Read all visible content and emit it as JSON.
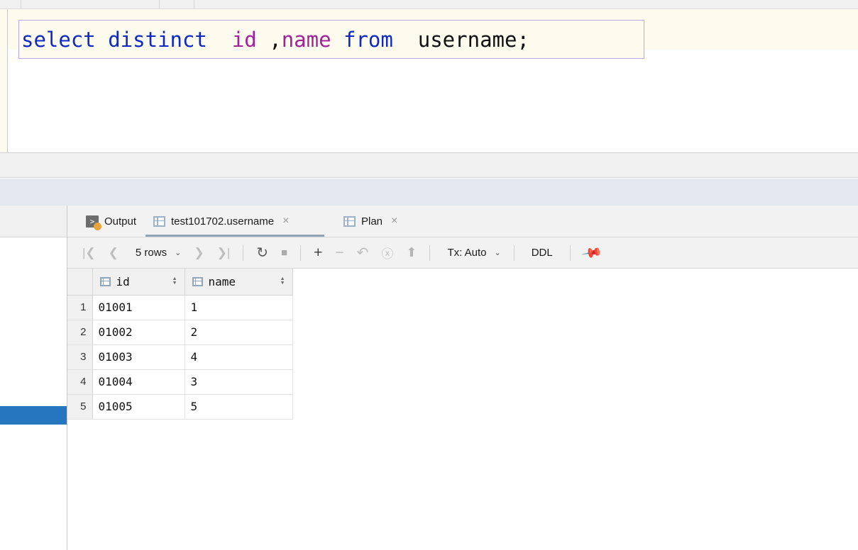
{
  "editor": {
    "sql_tokens": [
      {
        "text": "select distinct",
        "kind": "keyword"
      },
      {
        "text": "  ",
        "kind": "plain"
      },
      {
        "text": "id",
        "kind": "column"
      },
      {
        "text": " ",
        "kind": "plain"
      },
      {
        "text": ",",
        "kind": "punct"
      },
      {
        "text": "name",
        "kind": "column"
      },
      {
        "text": " ",
        "kind": "plain"
      },
      {
        "text": "from",
        "kind": "keyword"
      },
      {
        "text": "  ",
        "kind": "plain"
      },
      {
        "text": "username",
        "kind": "table"
      }
    ],
    "statement": "select distinct  id ,name from  username;",
    "terminator": ";",
    "keyword_color": "#0f29c4",
    "column_color": "#a3219a",
    "identifier_color": "#111111",
    "selection_border_color": "#b9a8e8",
    "current_line_color": "#fcfbee"
  },
  "tabs": [
    {
      "label": "Output",
      "icon": "console-output-icon",
      "active": false,
      "closable": false
    },
    {
      "label": "test101702.username",
      "icon": "table-grid-icon",
      "active": true,
      "closable": true,
      "close_label": "×"
    },
    {
      "label": "Plan",
      "icon": "table-grid-icon",
      "active": false,
      "closable": true,
      "close_label": "×"
    }
  ],
  "result_toolbar": {
    "first_page": "|❮",
    "prev_page": "❮",
    "row_count": "5 rows",
    "row_count_chevron": "⌄",
    "next_page": "❯",
    "last_page": "❯|",
    "reload": "↻",
    "stop": "■",
    "add_row": "+",
    "remove_row": "−",
    "revert": "↶",
    "find_submit": "ⓧ",
    "upload": "⬆",
    "tx_mode": "Tx: Auto",
    "tx_chevron": "⌄",
    "ddl": "DDL",
    "pin": "📌"
  },
  "result_grid": {
    "columns": [
      {
        "name": "id",
        "icon": "column-icon"
      },
      {
        "name": "name",
        "icon": "column-icon"
      }
    ],
    "row_numbers": [
      "1",
      "2",
      "3",
      "4",
      "5"
    ],
    "rows": [
      {
        "id": "01001",
        "name": "1"
      },
      {
        "id": "01002",
        "name": "2"
      },
      {
        "id": "01003",
        "name": "4"
      },
      {
        "id": "01004",
        "name": "3"
      },
      {
        "id": "01005",
        "name": "5"
      }
    ]
  },
  "side_panel": {
    "selected_row_color": "#2675bf"
  }
}
